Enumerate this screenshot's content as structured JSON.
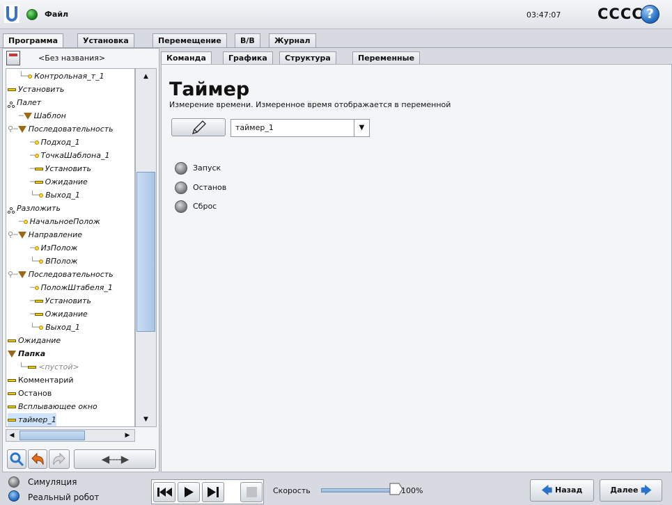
{
  "header": {
    "file_label": "Файл",
    "clock": "03:47:07",
    "robot_name": "CCCC",
    "help_label": "?"
  },
  "main_tabs": [
    {
      "label": "Программа",
      "active": true
    },
    {
      "label": "Установка",
      "active": false
    },
    {
      "label": "Перемещение",
      "active": false
    },
    {
      "label": "В/В",
      "active": false
    },
    {
      "label": "Журнал",
      "active": false
    }
  ],
  "program": {
    "name": "<Без названия>",
    "tree": [
      {
        "label": "Контрольная_т_1",
        "icon": "dot",
        "indent": 1,
        "connector": "└─"
      },
      {
        "label": "Установить",
        "icon": "bar",
        "indent": 0
      },
      {
        "label": "Палет",
        "icon": "pallet",
        "indent": 0
      },
      {
        "label": "Шаблон",
        "icon": "tri",
        "indent": 1,
        "connector": "─"
      },
      {
        "label": "Последовательность",
        "icon": "tri",
        "indent": 0,
        "connector": "⚲─"
      },
      {
        "label": "Подход_1",
        "icon": "dot",
        "indent": 2,
        "connector": "─"
      },
      {
        "label": "ТочкаШаблона_1",
        "icon": "dot",
        "indent": 2,
        "connector": "─"
      },
      {
        "label": "Установить",
        "icon": "bar",
        "indent": 2,
        "connector": "─"
      },
      {
        "label": "Ожидание",
        "icon": "bar",
        "indent": 2,
        "connector": "─"
      },
      {
        "label": "Выход_1",
        "icon": "dot",
        "indent": 2,
        "connector": "└─"
      },
      {
        "label": "Разложить",
        "icon": "pallet",
        "indent": 0
      },
      {
        "label": "НачальноеПолож",
        "icon": "dot",
        "indent": 1,
        "connector": "─"
      },
      {
        "label": "Направление",
        "icon": "tri",
        "indent": 0,
        "connector": "⚲─"
      },
      {
        "label": "ИзПолож",
        "icon": "dot",
        "indent": 2,
        "connector": "─"
      },
      {
        "label": "ВПолож",
        "icon": "dot",
        "indent": 2,
        "connector": "└─"
      },
      {
        "label": "Последовательность",
        "icon": "tri",
        "indent": 0,
        "connector": "⚲─"
      },
      {
        "label": "ПоложШтабеля_1",
        "icon": "dot",
        "indent": 2,
        "connector": "─"
      },
      {
        "label": "Установить",
        "icon": "bar",
        "indent": 2,
        "connector": "─"
      },
      {
        "label": "Ожидание",
        "icon": "bar",
        "indent": 2,
        "connector": "─"
      },
      {
        "label": "Выход_1",
        "icon": "dot",
        "indent": 2,
        "connector": "└─"
      },
      {
        "label": "Ожидание",
        "icon": "bar",
        "indent": 0
      },
      {
        "label": "Папка",
        "icon": "tri",
        "indent": 0,
        "bold": true
      },
      {
        "label": "<пустой>",
        "icon": "bar",
        "indent": 1,
        "connector": "└─",
        "muted": true
      },
      {
        "label": "Комментарий",
        "icon": "bar",
        "indent": 0,
        "upright": true
      },
      {
        "label": "Останов",
        "icon": "bar",
        "indent": 0,
        "upright": true
      },
      {
        "label": "Всплывающее окно",
        "icon": "bar",
        "indent": 0
      },
      {
        "label": "таймер_1",
        "icon": "bar",
        "indent": 0,
        "selected": true
      }
    ]
  },
  "sub_tabs": [
    {
      "label": "Команда",
      "active": true
    },
    {
      "label": "Графика",
      "active": false
    },
    {
      "label": "Структура",
      "active": false
    },
    {
      "label": "Переменные",
      "active": false
    }
  ],
  "command": {
    "title": "Таймер",
    "description": "Измерение времени. Измеренное время отображается в переменной",
    "variable_value": "таймер_1",
    "options": [
      "Запуск",
      "Останов",
      "Сброс"
    ]
  },
  "footer": {
    "simulation_label": "Симуляция",
    "real_robot_label": "Реальный робот",
    "speed_label": "Скорость",
    "speed_value": "100%",
    "speed_fraction": 1.0,
    "back_label": "Назад",
    "next_label": "Далее"
  },
  "colors": {
    "accent_blue": "#2a74c9",
    "node_yellow": "#f2d000",
    "selection": "#cfe3fb"
  }
}
